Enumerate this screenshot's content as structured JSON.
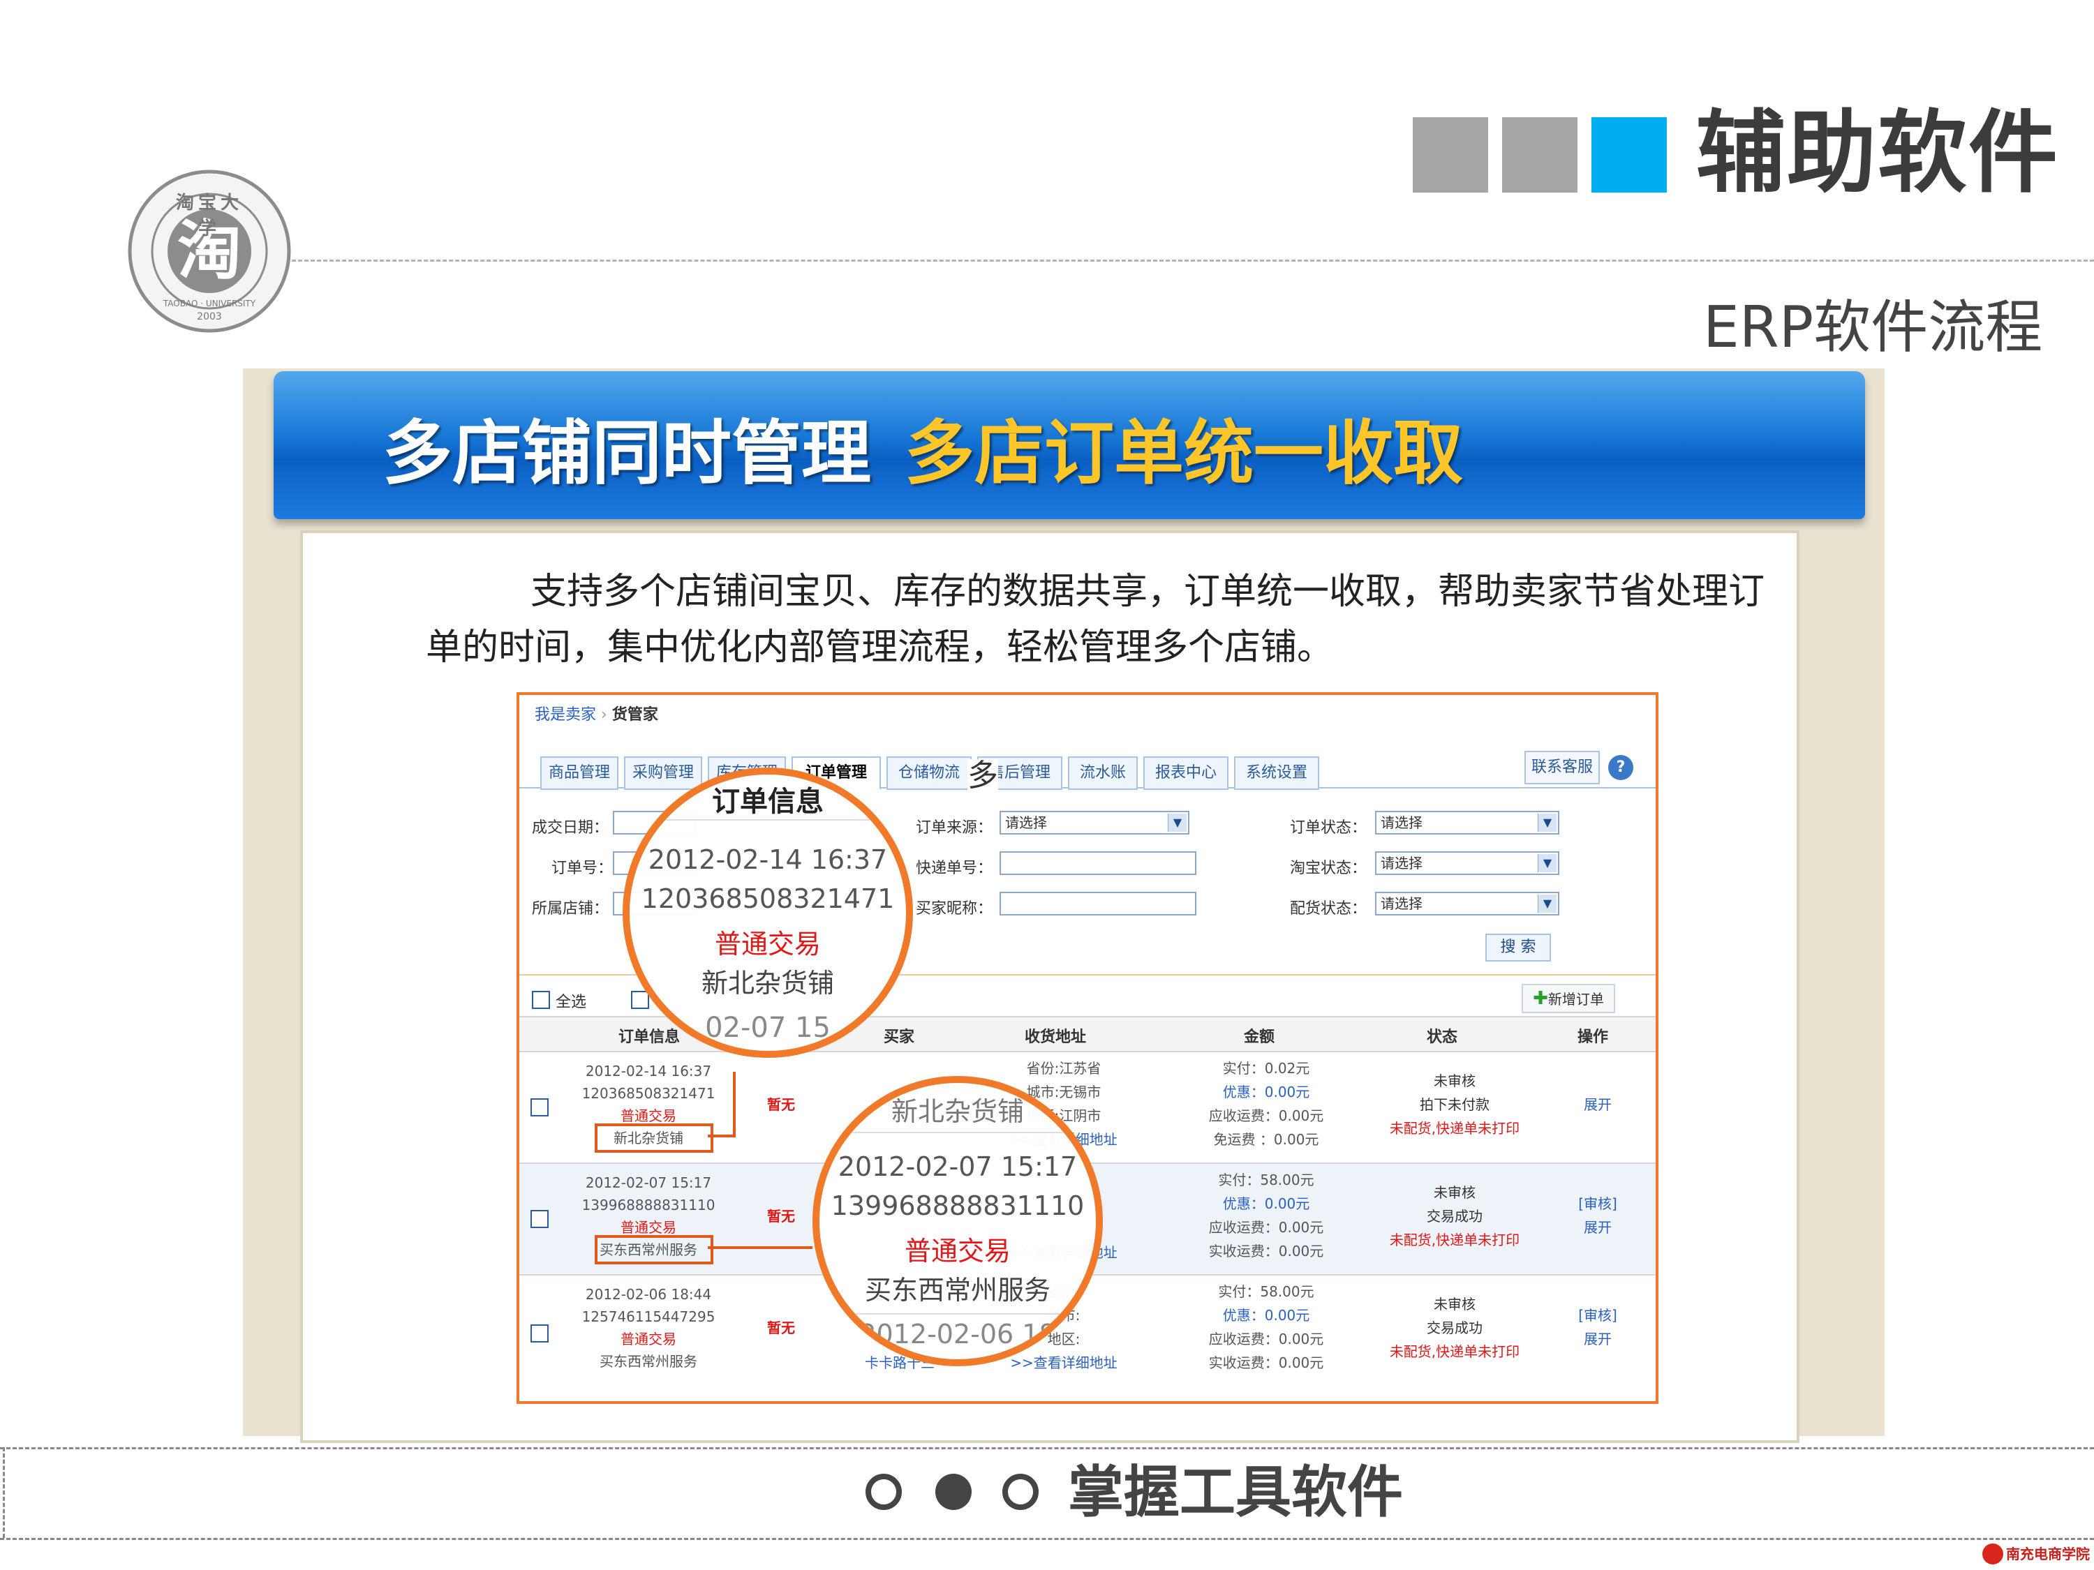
{
  "slide": {
    "title": "辅助软件",
    "subtitle": "ERP软件流程",
    "square_colors": [
      "#a6a6a6",
      "#a6a6a6",
      "#00aeef"
    ],
    "footer_text": "掌握工具软件",
    "footer_dots": [
      "empty",
      "filled",
      "empty"
    ]
  },
  "logo": {
    "text": "淘宝大学",
    "glyph": "淘",
    "en": "TAOBAO · UNIVERSITY",
    "year": "2003"
  },
  "banner": {
    "left_text": "多店铺同时管理",
    "right_text": "多店订单统一收取"
  },
  "description": "支持多个店铺间宝贝、库存的数据共享，订单统一收取，帮助卖家节省处理订单的时间，集中优化内部管理流程，轻松管理多个店铺。",
  "app": {
    "breadcrumb": [
      "我是卖家",
      "货管家"
    ],
    "breadcrumb_sep": "›",
    "tabs": [
      "商品管理",
      "采购管理",
      "库存管理",
      "订单管理",
      "仓储物流",
      "售后管理",
      "流水账",
      "报表中心",
      "系统设置"
    ],
    "active_tab": "订单管理",
    "contact_button": "联系客服",
    "help_icon": "?",
    "filters": {
      "date_label": "成交日期：",
      "order_no_label": "订单号：",
      "store_label": "所属店铺：",
      "source_label": "订单来源：",
      "source_value": "请选择",
      "express_label": "快递单号：",
      "buyer_label": "买家昵称：",
      "status_label": "订单状态：",
      "status_value": "请选择",
      "taobao_status_label": "淘宝状态：",
      "taobao_status_value": "请选择",
      "delivery_label": "配货状态：",
      "delivery_value": "请选择",
      "search_button": "搜 索"
    },
    "select_all_label": "全选",
    "new_order_button": "新增订单",
    "columns": [
      "订单信息",
      "买家",
      "收货地址",
      "金额",
      "状态",
      "操作"
    ],
    "orders": [
      {
        "date": "2012-02-14 16:37",
        "id": "120368508321471",
        "type": "普通交易",
        "store": "新北杂货铺",
        "remark": "暂无",
        "address": [
          "省份:江苏省",
          "城市:无锡市",
          "地区:江阴市",
          ">>查看详细地址"
        ],
        "amount": [
          "实付：0.02元",
          "优惠：0.00元",
          "应收运费：0.00元",
          "免运费 ：0.00元"
        ],
        "status": [
          "未审核",
          "拍下未付款",
          "未配货,快递单未打印"
        ],
        "actions": [
          "展开"
        ]
      },
      {
        "date": "2012-02-07 15:17",
        "id": "139968888831110",
        "type": "普通交易",
        "store": "买东西常州服务",
        "remark": "暂无",
        "address": [
          ">>查看详细地址"
        ],
        "amount": [
          "实付：58.00元",
          "优惠：0.00元",
          "应收运费：0.00元",
          "实收运费：0.00元"
        ],
        "status": [
          "未审核",
          "交易成功",
          "未配货,快递单未打印"
        ],
        "actions": [
          "[审核]",
          "展开"
        ]
      },
      {
        "date": "2012-02-06 18:44",
        "id": "125746115447295",
        "type": "普通交易",
        "store": "买东西常州服务",
        "remark": "暂无",
        "buyer": "卡卡路十三",
        "address": [
          "省份:",
          "城市:",
          "地区:",
          ">>查看详细地址"
        ],
        "amount": [
          "实付：58.00元",
          "优惠：0.00元",
          "应收运费：0.00元",
          "实收运费：0.00元"
        ],
        "status": [
          "未审核",
          "交易成功",
          "未配货,快递单未打印"
        ],
        "actions": [
          "[审核]",
          "展开"
        ]
      }
    ],
    "zoom_top": {
      "heading": "订单信息",
      "date": "2012-02-14 16:37",
      "id": "120368508321471",
      "type": "普通交易",
      "store": "新北杂货铺",
      "tail": "02-07 15"
    },
    "zoom_bottom": {
      "head": "新北杂货铺",
      "date": "2012-02-07 15:17",
      "id": "139968888831110",
      "type": "普通交易",
      "store": "买东西常州服务",
      "tail": "2012-02-06 18"
    },
    "tab_overlay": "多"
  },
  "corner_logo": "南充电商学院"
}
